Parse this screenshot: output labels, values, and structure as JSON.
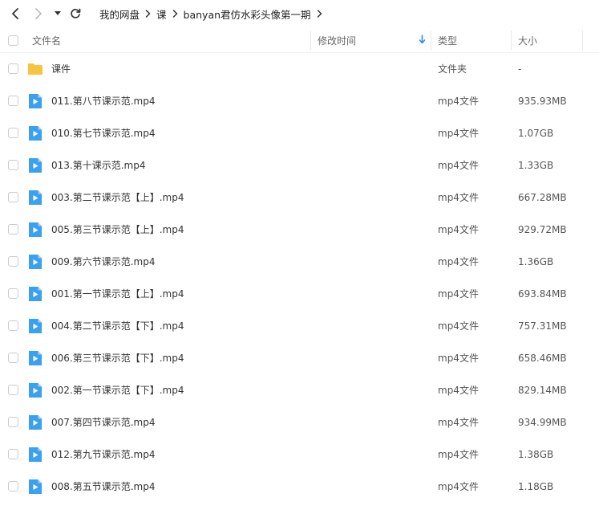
{
  "breadcrumb": [
    "我的网盘",
    "课",
    "banyan君仿水彩头像第一期"
  ],
  "header": {
    "name": "文件名",
    "modified": "修改时间",
    "type": "类型",
    "size": "大小"
  },
  "colors": {
    "folder": "#f7c440",
    "video": "#3aa0f0",
    "sort_arrow": "#2a8ef0"
  },
  "files": [
    {
      "name": "课件",
      "type": "文件夹",
      "size": "-",
      "icon": "folder-icon"
    },
    {
      "name": "011.第八节课示范.mp4",
      "type": "mp4文件",
      "size": "935.93MB",
      "icon": "video-file-icon"
    },
    {
      "name": "010.第七节课示范.mp4",
      "type": "mp4文件",
      "size": "1.07GB",
      "icon": "video-file-icon"
    },
    {
      "name": "013.第十课示范.mp4",
      "type": "mp4文件",
      "size": "1.33GB",
      "icon": "video-file-icon"
    },
    {
      "name": "003.第二节课示范【上】.mp4",
      "type": "mp4文件",
      "size": "667.28MB",
      "icon": "video-file-icon"
    },
    {
      "name": "005.第三节课示范【上】.mp4",
      "type": "mp4文件",
      "size": "929.72MB",
      "icon": "video-file-icon"
    },
    {
      "name": "009.第六节课示范.mp4",
      "type": "mp4文件",
      "size": "1.36GB",
      "icon": "video-file-icon"
    },
    {
      "name": "001.第一节课示范【上】.mp4",
      "type": "mp4文件",
      "size": "693.84MB",
      "icon": "video-file-icon"
    },
    {
      "name": "004.第二节课示范【下】.mp4",
      "type": "mp4文件",
      "size": "757.31MB",
      "icon": "video-file-icon"
    },
    {
      "name": "006.第三节课示范【下】.mp4",
      "type": "mp4文件",
      "size": "658.46MB",
      "icon": "video-file-icon"
    },
    {
      "name": "002.第一节课示范【下】.mp4",
      "type": "mp4文件",
      "size": "829.14MB",
      "icon": "video-file-icon"
    },
    {
      "name": "007.第四节课示范.mp4",
      "type": "mp4文件",
      "size": "934.99MB",
      "icon": "video-file-icon"
    },
    {
      "name": "012.第九节课示范.mp4",
      "type": "mp4文件",
      "size": "1.38GB",
      "icon": "video-file-icon"
    },
    {
      "name": "008.第五节课示范.mp4",
      "type": "mp4文件",
      "size": "1.18GB",
      "icon": "video-file-icon"
    }
  ]
}
